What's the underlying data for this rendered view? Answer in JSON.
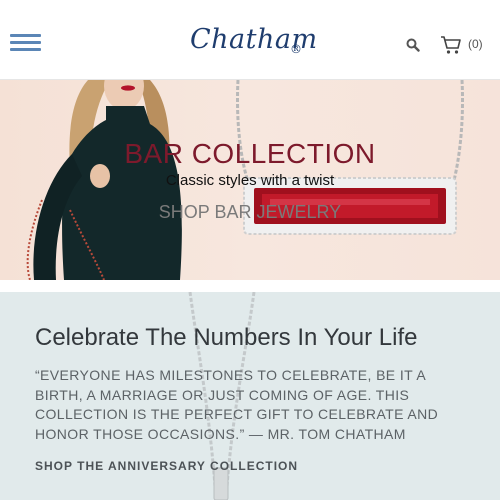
{
  "header": {
    "logo_text": "Chatham",
    "logo_mark": "®",
    "cart_count": "(0)",
    "icons": {
      "menu": "hamburger-icon",
      "search": "search-icon",
      "cart": "cart-icon"
    },
    "accent_color": "#5b86b6"
  },
  "hero": {
    "title": "BAR COLLECTION",
    "subtitle": "Classic styles with a twist",
    "link": "SHOP BAR JEWELRY",
    "title_color": "#7d1a2c",
    "background_color": "#f5e1d6"
  },
  "anniversary": {
    "title": "Celebrate The Numbers In Your Life",
    "quote": "“Everyone has milestones to celebrate, be it a birth, a marriage or just coming of age. This collection is the perfect gift to celebrate and honor those occasions.” — Mr. Tom Chatham",
    "link": "SHOP THE ANNIVERSARY COLLECTION",
    "background_color": "#e1eaeb"
  }
}
